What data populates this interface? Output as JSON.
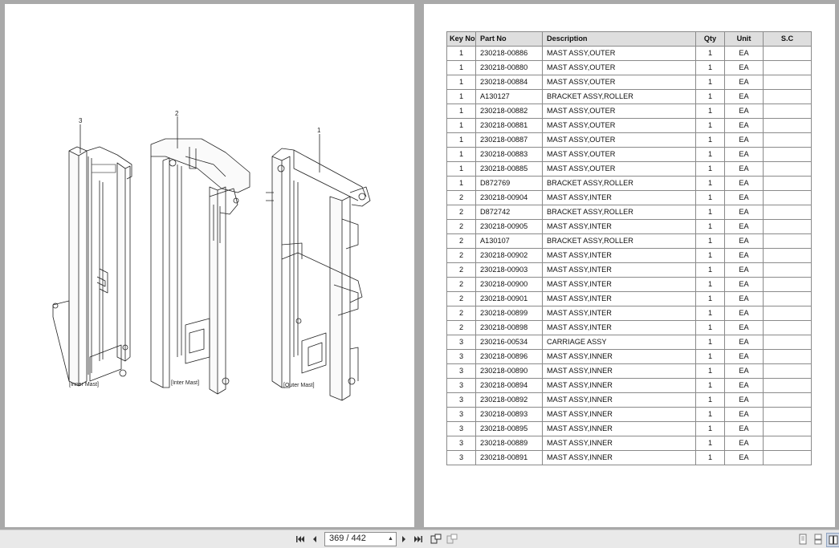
{
  "drawing": {
    "labels": {
      "inner_mast": "[Inner Mast]",
      "inter_mast": "[Inter Mast]",
      "outer_mast": "[Outer Mast]",
      "key_3": "3",
      "key_2": "2",
      "key_1": "1"
    }
  },
  "table": {
    "headers": [
      "Key No",
      "Part No",
      "Description",
      "Qty",
      "Unit",
      "S.C"
    ],
    "rows": [
      [
        "1",
        "230218-00886",
        "MAST ASSY,OUTER",
        "1",
        "EA",
        ""
      ],
      [
        "1",
        "230218-00880",
        "MAST ASSY,OUTER",
        "1",
        "EA",
        ""
      ],
      [
        "1",
        "230218-00884",
        "MAST ASSY,OUTER",
        "1",
        "EA",
        ""
      ],
      [
        "1",
        "A130127",
        "BRACKET ASSY,ROLLER",
        "1",
        "EA",
        ""
      ],
      [
        "1",
        "230218-00882",
        "MAST ASSY,OUTER",
        "1",
        "EA",
        ""
      ],
      [
        "1",
        "230218-00881",
        "MAST ASSY,OUTER",
        "1",
        "EA",
        ""
      ],
      [
        "1",
        "230218-00887",
        "MAST ASSY,OUTER",
        "1",
        "EA",
        ""
      ],
      [
        "1",
        "230218-00883",
        "MAST ASSY,OUTER",
        "1",
        "EA",
        ""
      ],
      [
        "1",
        "230218-00885",
        "MAST ASSY,OUTER",
        "1",
        "EA",
        ""
      ],
      [
        "1",
        "D872769",
        "BRACKET ASSY,ROLLER",
        "1",
        "EA",
        ""
      ],
      [
        "2",
        "230218-00904",
        "MAST ASSY,INTER",
        "1",
        "EA",
        ""
      ],
      [
        "2",
        "D872742",
        "BRACKET ASSY,ROLLER",
        "1",
        "EA",
        ""
      ],
      [
        "2",
        "230218-00905",
        "MAST ASSY,INTER",
        "1",
        "EA",
        ""
      ],
      [
        "2",
        "A130107",
        "BRACKET ASSY,ROLLER",
        "1",
        "EA",
        ""
      ],
      [
        "2",
        "230218-00902",
        "MAST ASSY,INTER",
        "1",
        "EA",
        ""
      ],
      [
        "2",
        "230218-00903",
        "MAST ASSY,INTER",
        "1",
        "EA",
        ""
      ],
      [
        "2",
        "230218-00900",
        "MAST ASSY,INTER",
        "1",
        "EA",
        ""
      ],
      [
        "2",
        "230218-00901",
        "MAST ASSY,INTER",
        "1",
        "EA",
        ""
      ],
      [
        "2",
        "230218-00899",
        "MAST ASSY,INTER",
        "1",
        "EA",
        ""
      ],
      [
        "2",
        "230218-00898",
        "MAST ASSY,INTER",
        "1",
        "EA",
        ""
      ],
      [
        "3",
        "230216-00534",
        "CARRIAGE ASSY",
        "1",
        "EA",
        ""
      ],
      [
        "3",
        "230218-00896",
        "MAST ASSY,INNER",
        "1",
        "EA",
        ""
      ],
      [
        "3",
        "230218-00890",
        "MAST ASSY,INNER",
        "1",
        "EA",
        ""
      ],
      [
        "3",
        "230218-00894",
        "MAST ASSY,INNER",
        "1",
        "EA",
        ""
      ],
      [
        "3",
        "230218-00892",
        "MAST ASSY,INNER",
        "1",
        "EA",
        ""
      ],
      [
        "3",
        "230218-00893",
        "MAST ASSY,INNER",
        "1",
        "EA",
        ""
      ],
      [
        "3",
        "230218-00895",
        "MAST ASSY,INNER",
        "1",
        "EA",
        ""
      ],
      [
        "3",
        "230218-00889",
        "MAST ASSY,INNER",
        "1",
        "EA",
        ""
      ],
      [
        "3",
        "230218-00891",
        "MAST ASSY,INNER",
        "1",
        "EA",
        ""
      ]
    ]
  },
  "toolbar": {
    "page_indicator": "369 / 442",
    "icons": [
      "first-page-icon",
      "prev-page-icon",
      "next-page-icon",
      "last-page-icon",
      "rotate-icon",
      "rotate-disabled-icon",
      "single-page-view-icon",
      "continuous-view-icon",
      "facing-pages-icon"
    ]
  }
}
